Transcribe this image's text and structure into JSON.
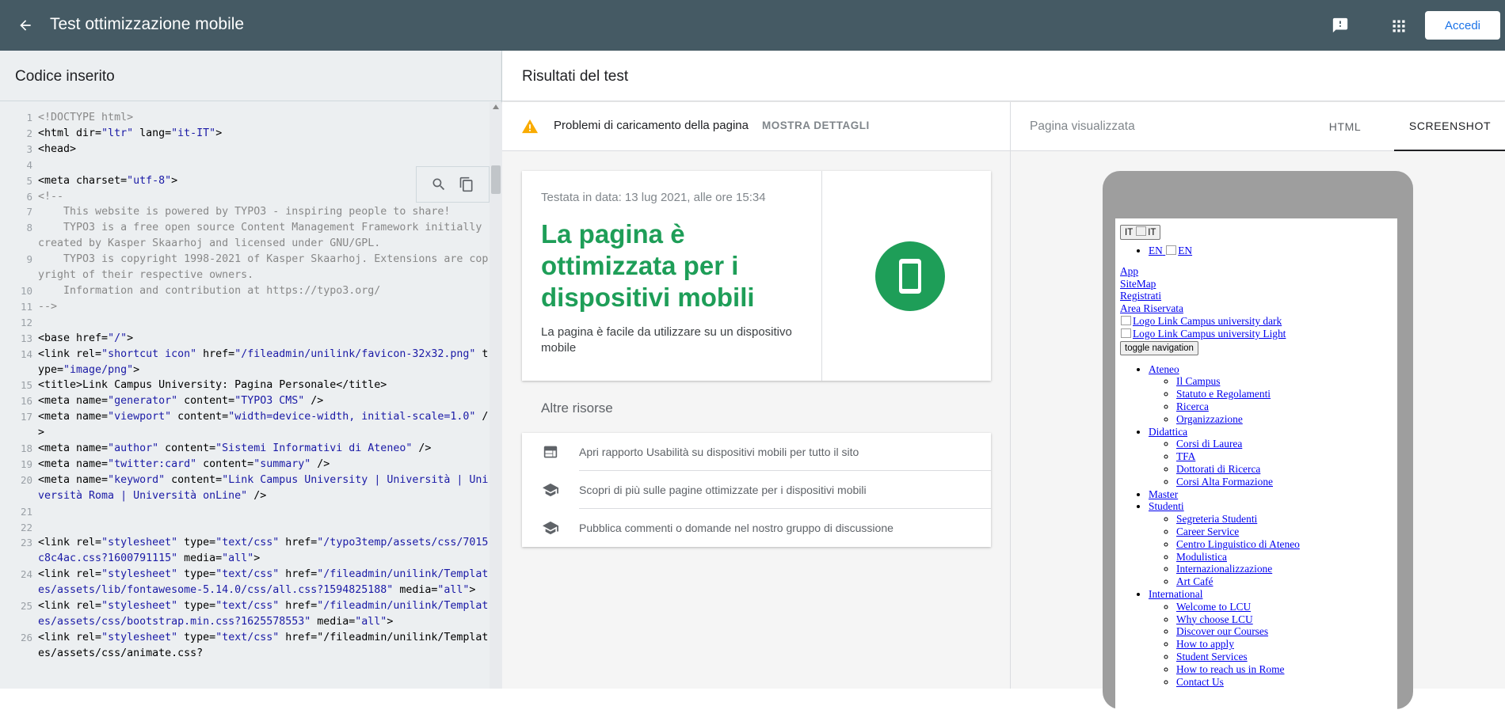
{
  "topbar": {
    "title": "Test ottimizzazione mobile",
    "login_label": "Accedi"
  },
  "left": {
    "header": "Codice inserito",
    "code_lines": [
      {
        "n": "1",
        "text": "<!DOCTYPE html>"
      },
      {
        "n": "2",
        "text": "<html dir=\"ltr\" lang=\"it-IT\">"
      },
      {
        "n": "3",
        "text": "<head>"
      },
      {
        "n": "4",
        "text": ""
      },
      {
        "n": "5",
        "text": "<meta charset=\"utf-8\">"
      },
      {
        "n": "6",
        "text": "<!--"
      },
      {
        "n": "7",
        "text": "    This website is powered by TYPO3 - inspiring people to share!"
      },
      {
        "n": "8",
        "text": "    TYPO3 is a free open source Content Management Framework initially created by Kasper Skaarhoj and licensed under GNU/GPL."
      },
      {
        "n": "9",
        "text": "    TYPO3 is copyright 1998-2021 of Kasper Skaarhoj. Extensions are copyright of their respective owners."
      },
      {
        "n": "10",
        "text": "    Information and contribution at https://typo3.org/"
      },
      {
        "n": "11",
        "text": "-->"
      },
      {
        "n": "12",
        "text": ""
      },
      {
        "n": "13",
        "text": "<base href=\"/\">"
      },
      {
        "n": "14",
        "text": "<link rel=\"shortcut icon\" href=\"/fileadmin/unilink/favicon-32x32.png\" type=\"image/png\">"
      },
      {
        "n": "15",
        "text": "<title>Link Campus University: Pagina Personale</title>"
      },
      {
        "n": "16",
        "text": "<meta name=\"generator\" content=\"TYPO3 CMS\" />"
      },
      {
        "n": "17",
        "text": "<meta name=\"viewport\" content=\"width=device-width, initial-scale=1.0\" />"
      },
      {
        "n": "18",
        "text": "<meta name=\"author\" content=\"Sistemi Informativi di Ateneo\" />"
      },
      {
        "n": "19",
        "text": "<meta name=\"twitter:card\" content=\"summary\" />"
      },
      {
        "n": "20",
        "text": "<meta name=\"keyword\" content=\"Link Campus University | Università | Università Roma | Università onLine\" />"
      },
      {
        "n": "21",
        "text": ""
      },
      {
        "n": "22",
        "text": ""
      },
      {
        "n": "23",
        "text": "<link rel=\"stylesheet\" type=\"text/css\" href=\"/typo3temp/assets/css/7015c8c4ac.css?1600791115\" media=\"all\">"
      },
      {
        "n": "24",
        "text": "<link rel=\"stylesheet\" type=\"text/css\" href=\"/fileadmin/unilink/Templates/assets/lib/fontawesome-5.14.0/css/all.css?1594825188\" media=\"all\">"
      },
      {
        "n": "25",
        "text": "<link rel=\"stylesheet\" type=\"text/css\" href=\"/fileadmin/unilink/Templates/assets/css/bootstrap.min.css?1625578553\" media=\"all\">"
      },
      {
        "n": "26",
        "text": "<link rel=\"stylesheet\" type=\"text/css\" href=\"/fileadmin/unilink/Templates/assets/css/animate.css?"
      }
    ]
  },
  "results": {
    "header": "Risultati del test",
    "warning_text": "Problemi di caricamento della pagina",
    "warning_link": "MOSTRA DETTAGLI",
    "tested_on": "Testata in data: 13 lug 2021, alle ore 15:34",
    "verdict": "La pagina è ottimizzata per i dispositivi mobili",
    "verdict_sub": "La pagina è facile da utilizzare su un dispositivo mobile",
    "resources_title": "Altre risorse",
    "resources": [
      {
        "icon": "web-icon",
        "label": "Apri rapporto Usabilità su dispositivi mobili per tutto il sito"
      },
      {
        "icon": "school-icon",
        "label": "Scopri di più sulle pagine ottimizzate per i dispositivi mobili"
      },
      {
        "icon": "school-icon",
        "label": "Pubblica commenti o domande nel nostro gruppo di discussione"
      }
    ]
  },
  "screenshot": {
    "label": "Pagina visualizzata",
    "tab_html": "HTML",
    "tab_screenshot": "SCREENSHOT",
    "lang_button": "IT",
    "lang_alt": "IT",
    "en_link": "EN",
    "en_alt": "EN",
    "links": [
      "App",
      "SiteMap",
      "Registrati",
      "Area Riservata",
      "Logo Link Campus university dark",
      "Logo Link Campus university Light"
    ],
    "toggle": "toggle navigation",
    "nav": [
      {
        "label": "Ateneo",
        "children": [
          "Il Campus",
          "Statuto e Regolamenti",
          "Ricerca",
          "Organizzazione"
        ]
      },
      {
        "label": "Didattica",
        "children": [
          "Corsi di Laurea",
          "TFA",
          "Dottorati di Ricerca",
          "Corsi Alta Formazione"
        ]
      },
      {
        "label": "Master",
        "children": []
      },
      {
        "label": "Studenti",
        "children": [
          "Segreteria Studenti",
          "Career Service",
          "Centro Linguistico di Ateneo",
          "Modulistica",
          "Internazionalizzazione",
          "Art Café"
        ]
      },
      {
        "label": "International",
        "children": [
          "Welcome to LCU",
          "Why choose LCU",
          "Discover our Courses",
          "How to apply",
          "Student Services",
          "How to reach us in Rome",
          "Contact Us"
        ]
      }
    ]
  },
  "colors": {
    "topbar": "#455a64",
    "success": "#1e9e58",
    "warning": "#f9ab00",
    "link": "#1a73e8"
  }
}
